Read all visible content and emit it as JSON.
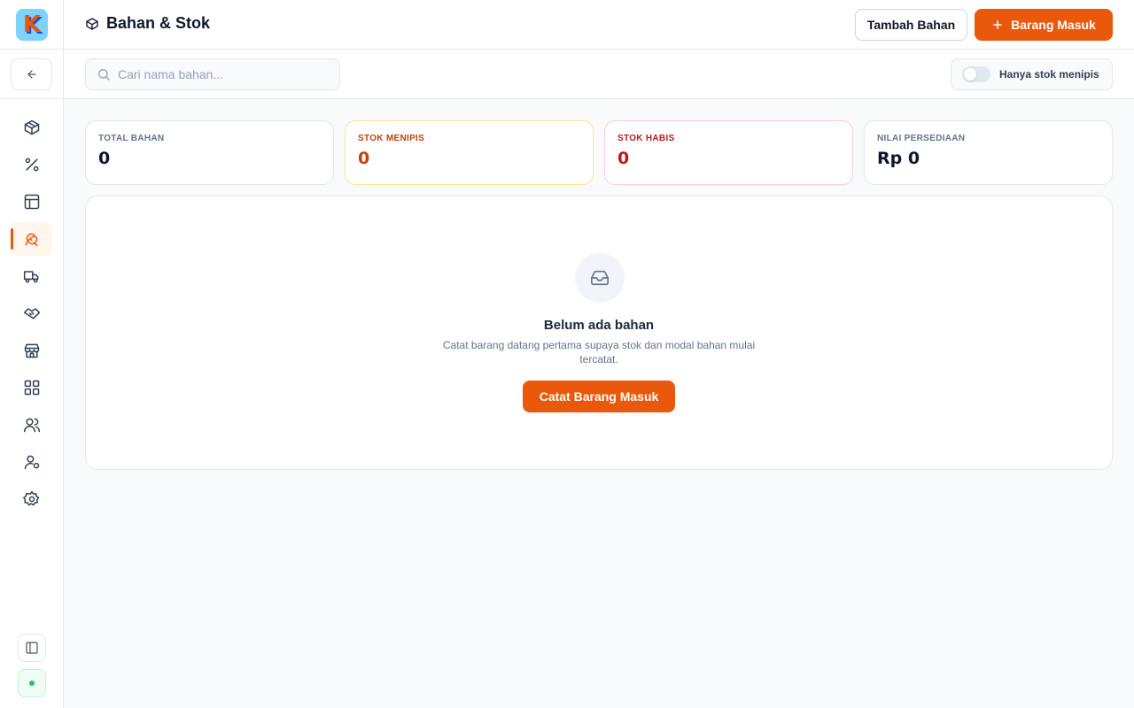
{
  "app": {
    "logo_letter": "K"
  },
  "sidebar": {
    "items": [
      {
        "icon": "package-icon",
        "active": false
      },
      {
        "icon": "percent-icon",
        "active": false
      },
      {
        "icon": "layout-icon",
        "active": false
      },
      {
        "icon": "ingredients-icon",
        "active": true
      },
      {
        "icon": "truck-icon",
        "active": false
      },
      {
        "icon": "handshake-icon",
        "active": false
      },
      {
        "icon": "store-icon",
        "active": false
      },
      {
        "icon": "grid-icon",
        "active": false
      },
      {
        "icon": "users-icon",
        "active": false
      },
      {
        "icon": "user-cog-icon",
        "active": false
      },
      {
        "icon": "gear-icon",
        "active": false
      }
    ]
  },
  "header": {
    "title": "Bahan & Stok",
    "add_material_label": "Tambah Bahan",
    "incoming_label": "Barang Masuk"
  },
  "toolbar": {
    "search_placeholder": "Cari nama bahan...",
    "search_value": "",
    "low_stock_toggle_label": "Hanya stok menipis",
    "low_stock_only": false
  },
  "stats": {
    "total": {
      "label": "TOTAL BAHAN",
      "value": "0"
    },
    "low": {
      "label": "STOK MENIPIS",
      "value": "0"
    },
    "out": {
      "label": "STOK HABIS",
      "value": "0"
    },
    "inventory_value": {
      "label": "NILAI PERSEDIAAN",
      "value": "Rp 0"
    }
  },
  "empty_state": {
    "title": "Belum ada bahan",
    "description": "Catat barang datang pertama supaya stok dan modal bahan mulai tercatat.",
    "cta_label": "Catat Barang Masuk"
  },
  "colors": {
    "accent": "#ea580c",
    "warning": "#c2410c",
    "danger": "#b91c1c",
    "online": "#22c55e"
  }
}
